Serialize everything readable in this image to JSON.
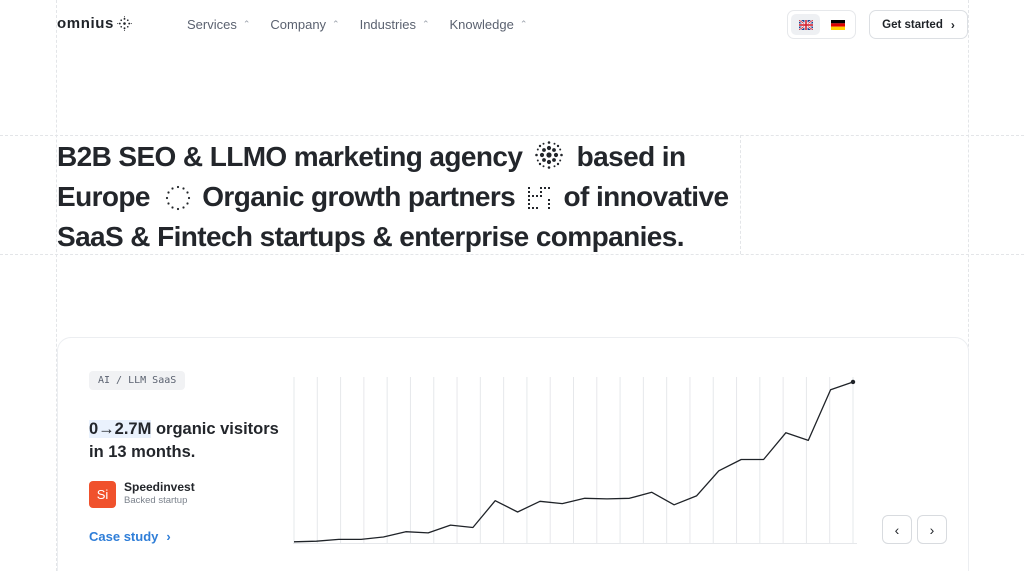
{
  "header": {
    "logo_text": "omnius",
    "nav": [
      {
        "label": "Services",
        "icon": "chevron-updown-icon"
      },
      {
        "label": "Company",
        "icon": "chevron-updown-icon"
      },
      {
        "label": "Industries",
        "icon": "chevron-updown-icon"
      },
      {
        "label": "Knowledge",
        "icon": "chevron-updown-icon"
      }
    ],
    "languages": [
      {
        "code": "en",
        "icon": "uk-flag-icon",
        "active": true
      },
      {
        "code": "de",
        "icon": "germany-flag-icon",
        "active": false
      }
    ],
    "cta_label": "Get started",
    "cta_icon": "chevron-right-icon"
  },
  "hero": {
    "part1": "B2B SEO & LLMO marketing agency",
    "part2": "based in Europe",
    "part3": "Organic growth partners",
    "part4": "of innovative SaaS & Fintech startups & enterprise companies.",
    "icons": [
      "dot-sphere-icon",
      "dotted-circle-icon",
      "dotted-square-icon"
    ]
  },
  "case": {
    "tag": "AI / LLM SaaS",
    "headline_highlight": "0→2.7M",
    "headline_rest": "organic visitors in 13 months.",
    "company_logo_text": "Si",
    "company_name": "Speedinvest",
    "company_sub": "Backed startup",
    "link_label": "Case study",
    "prev_icon": "chevron-left-icon",
    "next_icon": "chevron-right-icon",
    "colors": {
      "link": "#2f7ed8",
      "logo_bg": "#f0512c",
      "highlight_bg": "#eaf2fd"
    }
  },
  "chart_data": {
    "type": "line",
    "x": [
      0,
      1,
      2,
      3,
      4,
      5,
      6,
      7,
      8,
      9,
      10,
      11,
      12,
      13,
      14,
      15,
      16,
      17,
      18,
      19,
      20,
      21,
      22,
      23,
      24
    ],
    "values": [
      0.02,
      0.03,
      0.06,
      0.06,
      0.1,
      0.19,
      0.17,
      0.3,
      0.26,
      0.71,
      0.52,
      0.7,
      0.66,
      0.75,
      0.74,
      0.75,
      0.85,
      0.64,
      0.79,
      1.21,
      1.4,
      1.4,
      1.85,
      1.72,
      2.57,
      2.7
    ],
    "ylim": [
      0,
      2.75
    ],
    "grid": "vertical",
    "title": "",
    "xlabel": "",
    "ylabel": "",
    "color": "#1f2328"
  }
}
